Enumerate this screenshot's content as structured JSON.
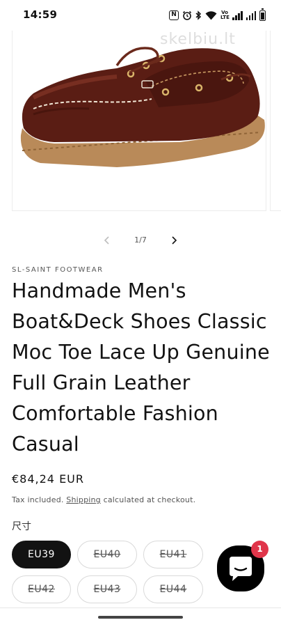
{
  "status_bar": {
    "time": "14:59",
    "icons": [
      "nfc-icon",
      "alarm-icon",
      "bluetooth-icon",
      "wifi-icon",
      "volte-icon",
      "signal-icon",
      "signal-icon",
      "battery-icon"
    ],
    "volte_text": "Vo LTE"
  },
  "gallery": {
    "watermark": "skelbiu.lt",
    "counter": "1/7",
    "prev_icon": "chevron-left-icon",
    "next_icon": "chevron-right-icon",
    "current": 1,
    "total": 7
  },
  "product": {
    "vendor": "SL-SAINT FOOTWEAR",
    "title": "Handmade Men's Boat&Deck Shoes Classic Moc Toe Lace Up Genuine Full Grain Leather Comfortable Fashion Casual",
    "price": "€84,24 EUR",
    "tax_prefix": "Tax included.",
    "shipping_link": "Shipping",
    "tax_suffix": "calculated at checkout."
  },
  "size_selector": {
    "label": "尺寸",
    "options": [
      {
        "label": "EU39",
        "selected": true,
        "available": true
      },
      {
        "label": "EU40",
        "selected": false,
        "available": false
      },
      {
        "label": "EU41",
        "selected": false,
        "available": false
      },
      {
        "label": "EU42",
        "selected": false,
        "available": false
      },
      {
        "label": "EU43",
        "selected": false,
        "available": false
      },
      {
        "label": "EU44",
        "selected": false,
        "available": false
      }
    ]
  },
  "chat": {
    "badge_count": "1",
    "icon": "chat-bubble-icon"
  },
  "colors": {
    "accent": "#121212",
    "badge": "#e0354a",
    "leather": "#5a1d14",
    "sole": "#b98a59"
  }
}
